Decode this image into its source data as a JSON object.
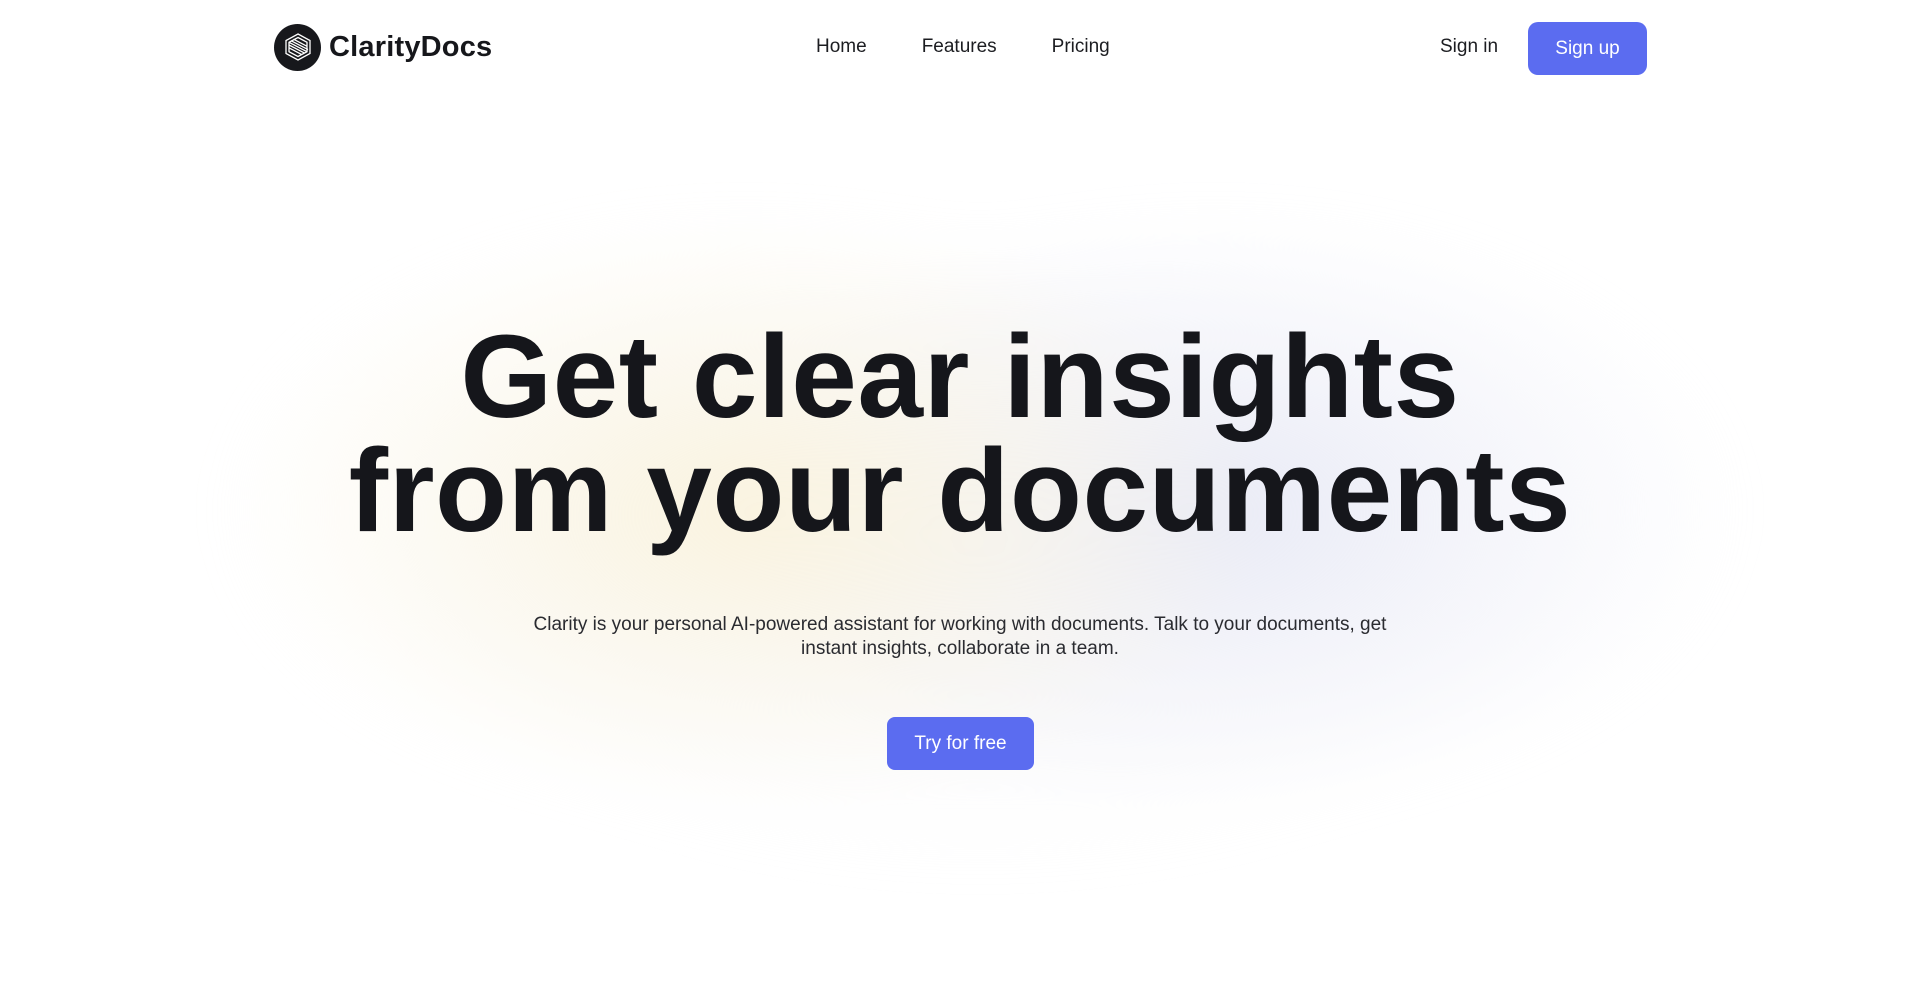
{
  "header": {
    "brand_name": "ClarityDocs",
    "logo_icon": "cube-logo-icon",
    "nav": {
      "home": "Home",
      "features": "Features",
      "pricing": "Pricing"
    },
    "sign_in": "Sign in",
    "sign_up": "Sign up"
  },
  "hero": {
    "title_line1": "Get clear insights",
    "title_line2": "from your documents",
    "subtitle_line1": "Clarity is your personal AI-powered assistant for working with documents. Talk to your documents, get",
    "subtitle_line2": "instant insights, collaborate in a team.",
    "cta": "Try for free"
  },
  "colors": {
    "accent": "#5b6cf0",
    "text": "#15161b",
    "background": "#ffffff"
  }
}
